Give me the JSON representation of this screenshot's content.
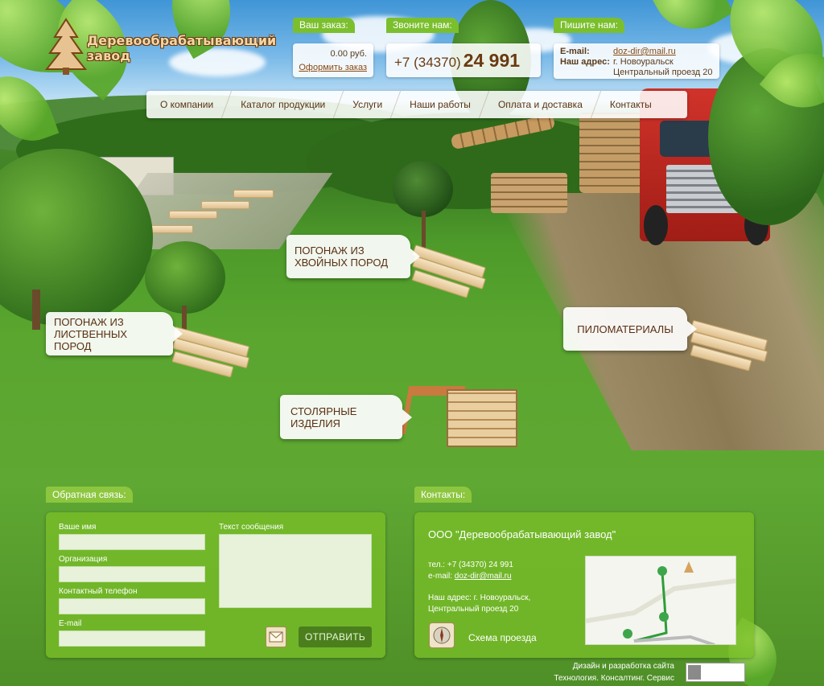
{
  "logo": {
    "line1": "Деревообрабатывающий",
    "line2": "завод"
  },
  "order": {
    "title": "Ваш заказ:",
    "sum": "0.00 руб.",
    "link": "Оформить заказ"
  },
  "phone": {
    "title": "Звоните нам:",
    "code": "+7 (34370)",
    "number": "24 991"
  },
  "contact_mail": {
    "title": "Пишите нам:",
    "email_label": "E-mail:",
    "email": "doz-dir@mail.ru",
    "address_label": "Наш адрес:",
    "address_line1": "г. Новоуральск",
    "address_line2": "Центральный проезд 20"
  },
  "nav": {
    "items": [
      {
        "label": "О компании"
      },
      {
        "label": "Каталог продукции"
      },
      {
        "label": "Услуги"
      },
      {
        "label": "Наши работы"
      },
      {
        "label": "Оплата и доставка"
      },
      {
        "label": "Контакты"
      }
    ]
  },
  "products": {
    "softwood": "Погонаж из хвойных пород",
    "hardwood": "Погонаж из лиственных пород",
    "lumber": "Пиломатериалы",
    "joinery": "Столярные изделия"
  },
  "feedback": {
    "title": "Обратная связь:",
    "name_label": "Ваше имя",
    "org_label": "Организация",
    "phone_label": "Контактный телефон",
    "email_label": "E-mail",
    "message_label": "Текст сообщения",
    "send_label": "ОТПРАВИТЬ"
  },
  "contacts": {
    "title": "Контакты:",
    "company": "ООО \"Деревообрабатывающий завод\"",
    "phone_label": "тел.:",
    "phone": "+7 (34370) 24 991",
    "email_label": "e-mail:",
    "email": "doz-dir@mail.ru",
    "address_line1": "Наш адрес: г. Новоуральск,",
    "address_line2": "Центральный проезд 20",
    "scheme_label": "Схема проезда"
  },
  "footer": {
    "credit_line1": "Дизайн и разработка сайта",
    "credit_line2": "Технология. Консалтинг. Сервис"
  },
  "colors": {
    "accent_green": "#7bbf2e",
    "panel_green": "#78be28",
    "button_dark": "#4b7f1d",
    "brown_text": "#5a2f12"
  }
}
